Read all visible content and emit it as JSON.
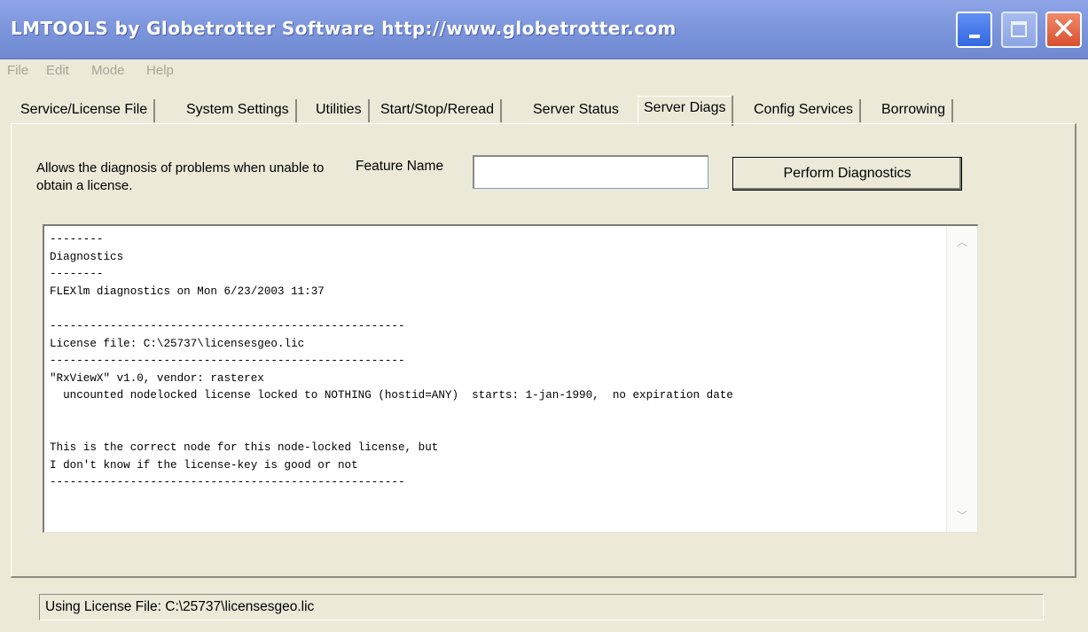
{
  "window": {
    "title": "LMTOOLS by Globetrotter Software http://www.globetrotter.com",
    "close_glyph": "✕"
  },
  "menu": [
    "File",
    "Edit",
    "Mode",
    "Help"
  ],
  "tabs": [
    {
      "label": "Service/License File"
    },
    {
      "label": "System Settings"
    },
    {
      "label": "Utilities"
    },
    {
      "label": "Start/Stop/Reread"
    },
    {
      "label": "Server Status"
    },
    {
      "label": "Server Diags",
      "active": true
    },
    {
      "label": "Config Services"
    },
    {
      "label": "Borrowing"
    }
  ],
  "diag": {
    "description": "Allows the diagnosis of problems when unable to obtain a license.",
    "feature_label": "Feature Name",
    "feature_value": "",
    "perform_label": "Perform Diagnostics",
    "output": "--------\nDiagnostics\n--------\nFLEXlm diagnostics on Mon 6/23/2003 11:37\n\n-----------------------------------------------------\nLicense file: C:\\25737\\licensesgeo.lic\n-----------------------------------------------------\n\"RxViewX\" v1.0, vendor: rasterex\n  uncounted nodelocked license locked to NOTHING (hostid=ANY)  starts: 1-jan-1990,  no expiration date\n\n\nThis is the correct node for this node-locked license, but\nI don't know if the license-key is good or not\n-----------------------------------------------------"
  },
  "scroll": {
    "up_glyph": "︿",
    "down_glyph": "﹀"
  },
  "status": {
    "text": "Using License File:  C:\\25737\\licensesgeo.lic"
  },
  "colors": {
    "titlebar": "#7d96dc",
    "face": "#ece9d8",
    "menu_text_disabled": "#a7a39a",
    "close_button": "#d7502e"
  },
  "icons": [
    "minimize-icon",
    "maximize-icon",
    "close-icon",
    "scroll-up-icon",
    "scroll-down-icon"
  ]
}
